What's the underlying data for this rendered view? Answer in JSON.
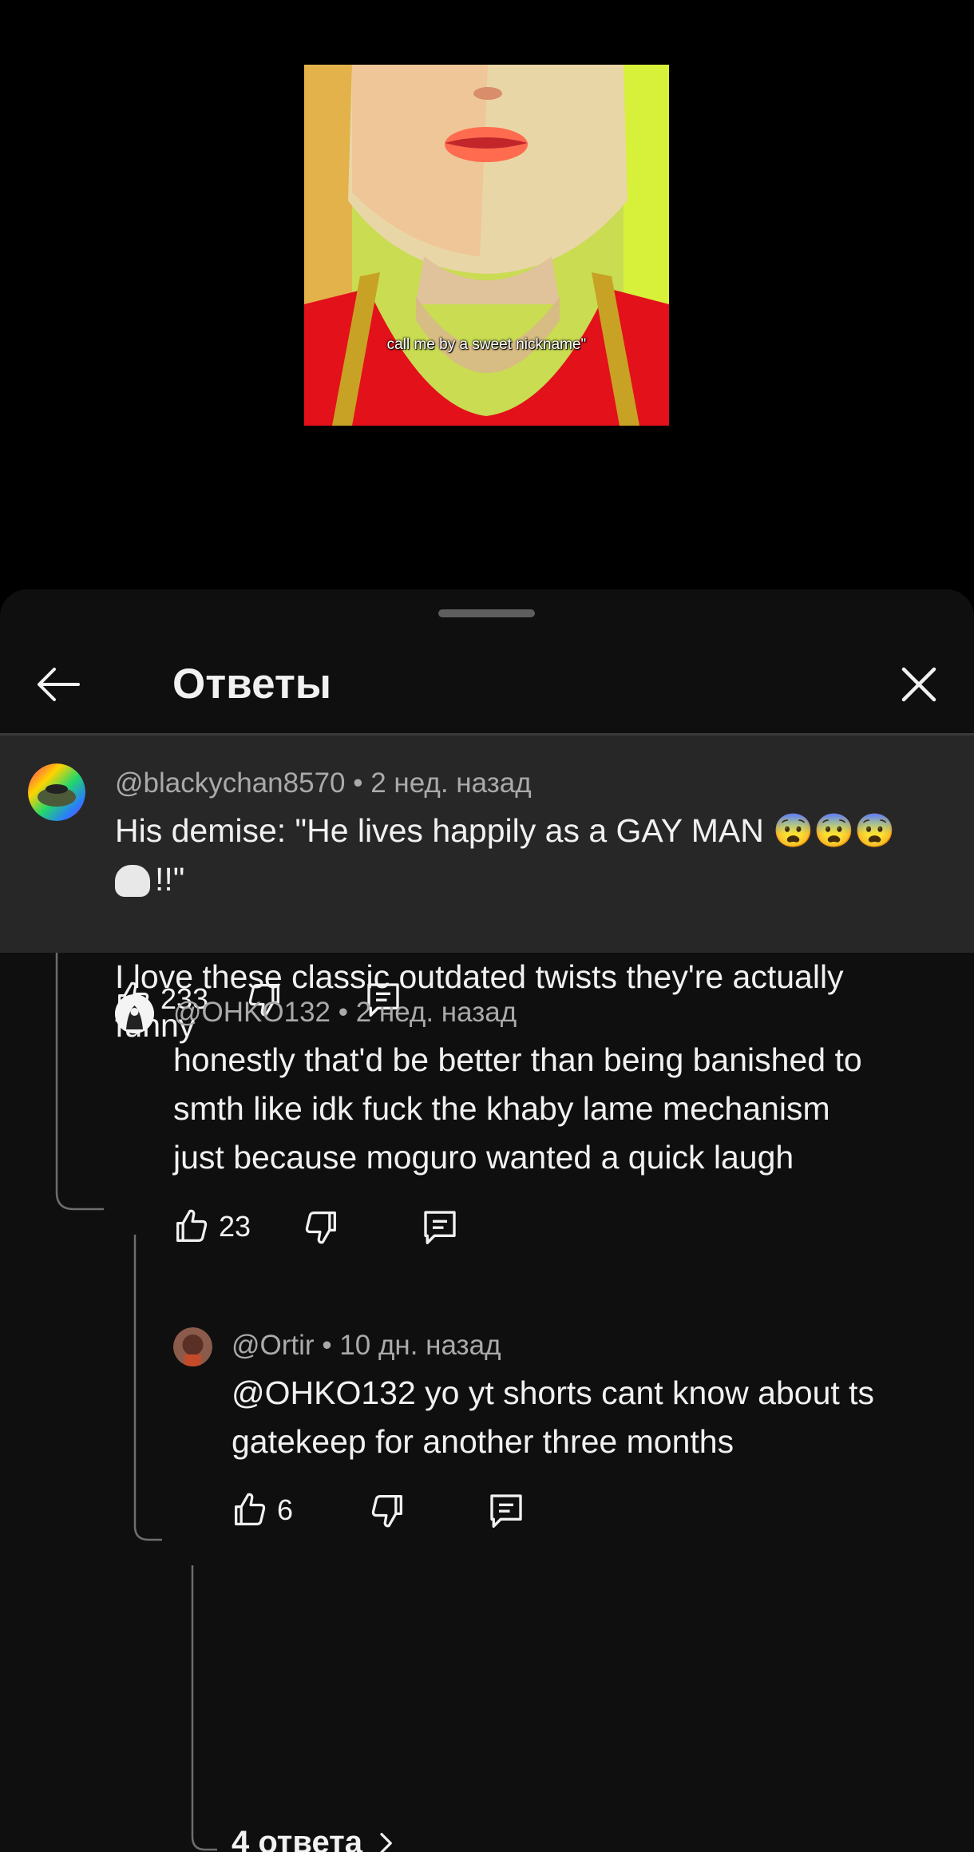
{
  "video": {
    "caption": "call me by a sweet nickname\""
  },
  "header": {
    "title": "Ответы",
    "back_icon": "arrow-left-icon",
    "close_icon": "close-icon"
  },
  "parent_comment": {
    "author": "@blackychan8570",
    "time": "2 нед. назад",
    "text_line1": "His demise: \"He lives happily as a GAY MAN",
    "emoji_1": "😨😨😨",
    "text_line2_suffix": "!!\"",
    "text_para2": "I love these classic outdated twists they're actually\nfunny",
    "likes": "233"
  },
  "replies": [
    {
      "author": "@OHKO132",
      "time": "2 нед. назад",
      "text": "honestly that'd be better than being banished to\nsmth like idk fuck the khaby lame mechanism\njust because moguro wanted a quick laugh",
      "likes": "23"
    },
    {
      "author": "@Ortir",
      "time": "10 дн. назад",
      "text": "@OHKO132 yo yt shorts cant know about ts\ngatekeep for another three months",
      "likes": "6"
    }
  ],
  "more_replies": {
    "label": "4 ответа"
  },
  "colors": {
    "background": "#0f0f0f",
    "highlight_row": "#272727",
    "meta_text": "#aaaaaa",
    "primary_text": "#f1f1f1"
  }
}
